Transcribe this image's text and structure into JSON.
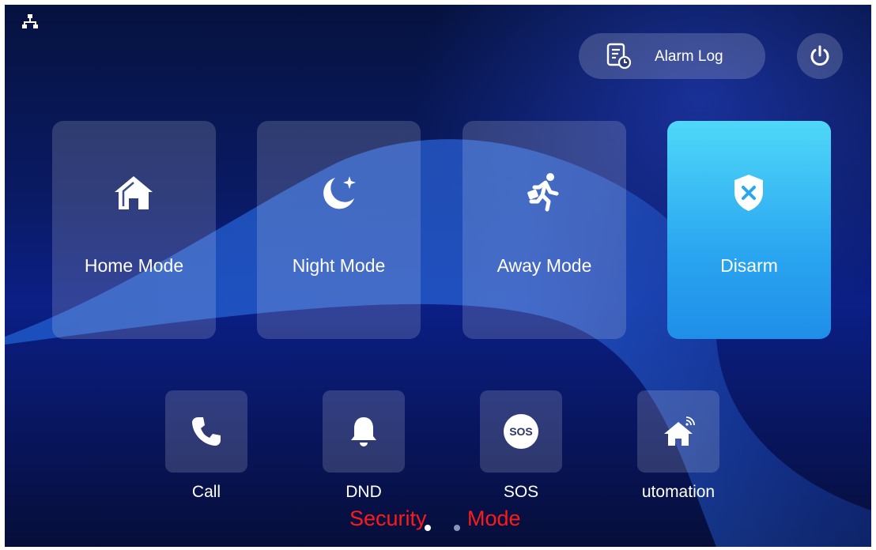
{
  "header": {
    "alarm_log_label": "Alarm Log"
  },
  "modes": [
    {
      "label": "Home Mode",
      "icon": "home-icon",
      "active": false
    },
    {
      "label": "Night Mode",
      "icon": "moon-star-icon",
      "active": false
    },
    {
      "label": "Away Mode",
      "icon": "running-person-icon",
      "active": false
    },
    {
      "label": "Disarm",
      "icon": "shield-x-icon",
      "active": true
    }
  ],
  "apps": [
    {
      "label": "Call",
      "icon": "phone-icon"
    },
    {
      "label": "DND",
      "icon": "bell-icon"
    },
    {
      "label": "SOS",
      "icon": "sos-icon",
      "badge": "SOS"
    },
    {
      "label": "utomation",
      "icon": "smart-home-icon"
    }
  ],
  "overlay": {
    "word1": "Security",
    "word2": "Mode"
  },
  "pager": {
    "pages": 2,
    "current": 1
  },
  "colors": {
    "active_card": "#2aa6f0",
    "overlay_text": "#ff1a1a"
  }
}
